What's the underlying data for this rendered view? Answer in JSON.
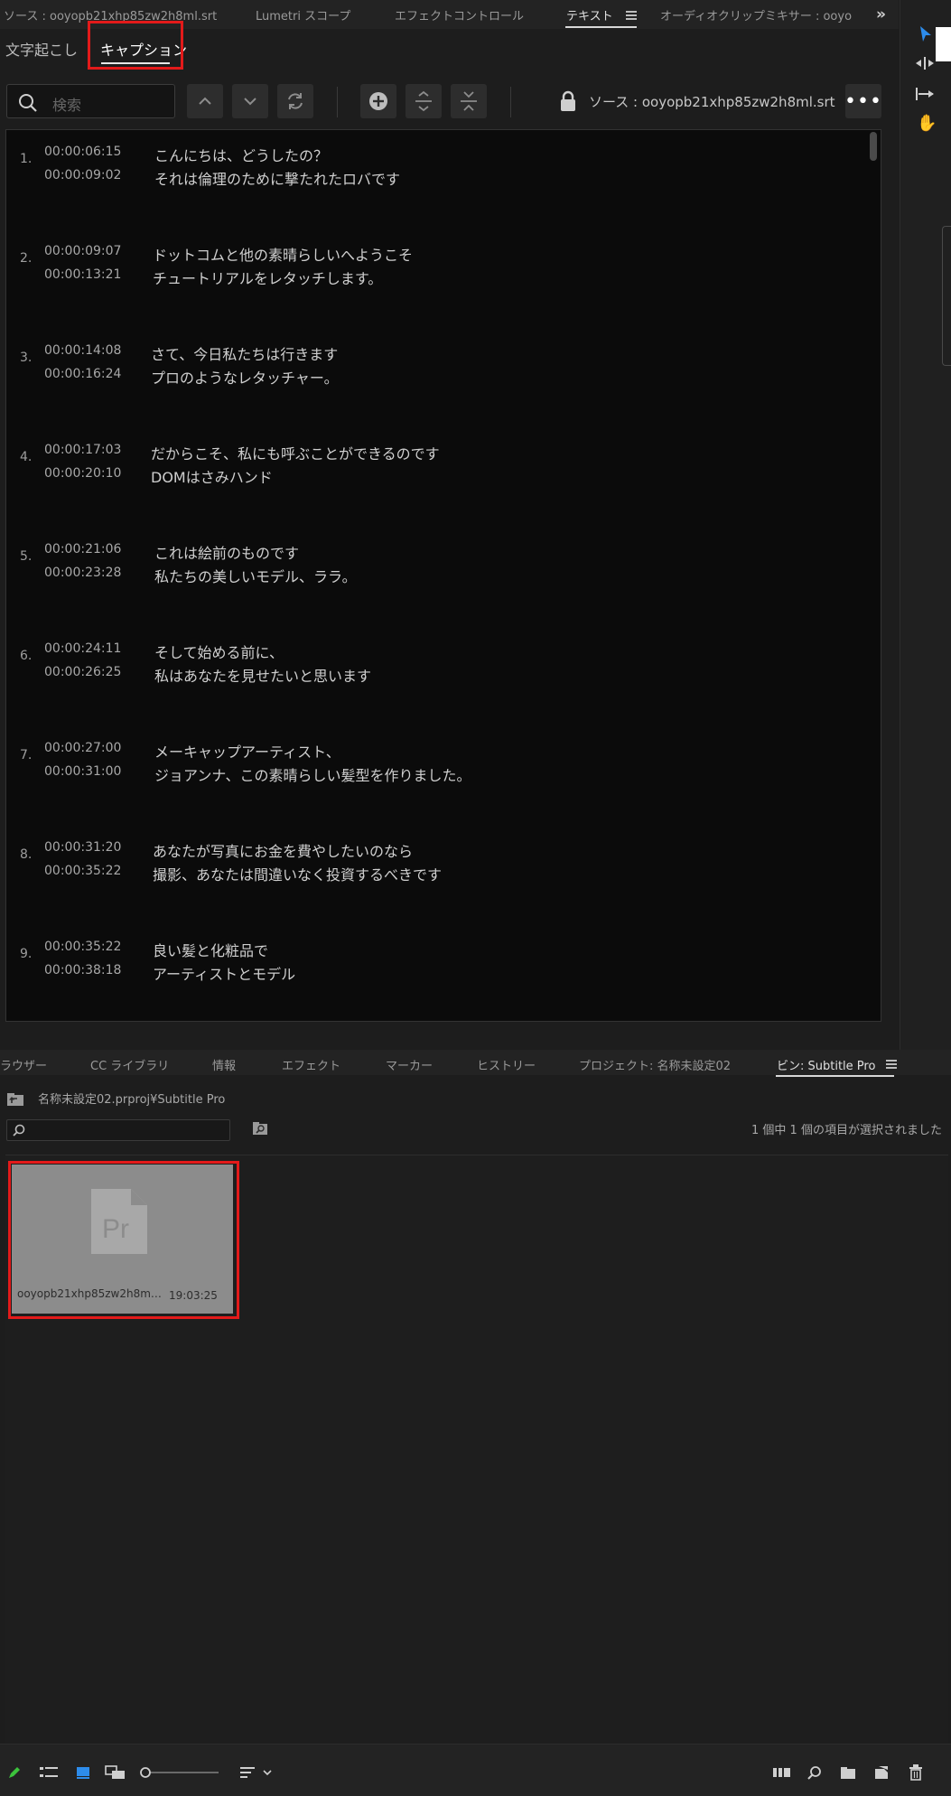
{
  "top_tabs": [
    {
      "label": "ソース : ooyopb21xhp85zw2h8ml.srt",
      "active": false
    },
    {
      "label": "Lumetri スコープ",
      "active": false
    },
    {
      "label": "エフェクトコントロール",
      "active": false
    },
    {
      "label": "テキスト",
      "active": true
    },
    {
      "label": "オーディオクリップミキサー : ooyo",
      "active": false
    }
  ],
  "text_panel": {
    "tabs": [
      {
        "label": "文字起こし",
        "active": false
      },
      {
        "label": "キャプション",
        "active": true
      }
    ],
    "search_placeholder": "検索",
    "source_label": "ソース : ooyopb21xhp85zw2h8ml.srt"
  },
  "captions": [
    {
      "num": "1.",
      "start": "00:00:06:15",
      "end": "00:00:09:02",
      "line1": "こんにちは、どうしたの？",
      "line2": "それは倫理のために撃たれたロバです"
    },
    {
      "num": "2.",
      "start": "00:00:09:07",
      "end": "00:00:13:21",
      "line1": "ドットコムと他の素晴らしいへようこそ",
      "line2": "チュートリアルをレタッチします。"
    },
    {
      "num": "3.",
      "start": "00:00:14:08",
      "end": "00:00:16:24",
      "line1": "さて、今日私たちは行きます",
      "line2": "プロのようなレタッチャー。"
    },
    {
      "num": "4.",
      "start": "00:00:17:03",
      "end": "00:00:20:10",
      "line1": "だからこそ、私にも呼ぶことができるのです",
      "line2": "DOMはさみハンド"
    },
    {
      "num": "5.",
      "start": "00:00:21:06",
      "end": "00:00:23:28",
      "line1": "これは絵前のものです",
      "line2": "私たちの美しいモデル、ララ。"
    },
    {
      "num": "6.",
      "start": "00:00:24:11",
      "end": "00:00:26:25",
      "line1": "そして始める前に、",
      "line2": "私はあなたを見せたいと思います"
    },
    {
      "num": "7.",
      "start": "00:00:27:00",
      "end": "00:00:31:00",
      "line1": "メーキャップアーティスト、",
      "line2": "ジョアンナ、この素晴らしい髪型を作りました。"
    },
    {
      "num": "8.",
      "start": "00:00:31:20",
      "end": "00:00:35:22",
      "line1": "あなたが写真にお金を費やしたいのなら",
      "line2": "撮影、あなたは間違いなく投資するべきです"
    },
    {
      "num": "9.",
      "start": "00:00:35:22",
      "end": "00:00:38:18",
      "line1": "良い髪と化粧品で",
      "line2": "アーティストとモデル"
    }
  ],
  "lower_tabs": [
    {
      "label": "ラウザー",
      "active": false
    },
    {
      "label": "CC ライブラリ",
      "active": false
    },
    {
      "label": "情報",
      "active": false
    },
    {
      "label": "エフェクト",
      "active": false
    },
    {
      "label": "マーカー",
      "active": false
    },
    {
      "label": "ヒストリー",
      "active": false
    },
    {
      "label": "プロジェクト: 名称未設定02",
      "active": false
    },
    {
      "label": "ビン: Subtitle Pro",
      "active": true
    }
  ],
  "bin": {
    "breadcrumb": "名称未設定02.prproj¥Subtitle Pro",
    "selection_status": "1 個中 1 個の項目が選択されました",
    "item": {
      "name": "ooyopb21xhp85zw2h8m…",
      "duration": "19:03:25",
      "icon_text": "Pr"
    }
  },
  "colors": {
    "accent_blue": "#2d8ceb",
    "highlight_red": "#e31a1a",
    "pencil_green": "#3cc33c"
  }
}
